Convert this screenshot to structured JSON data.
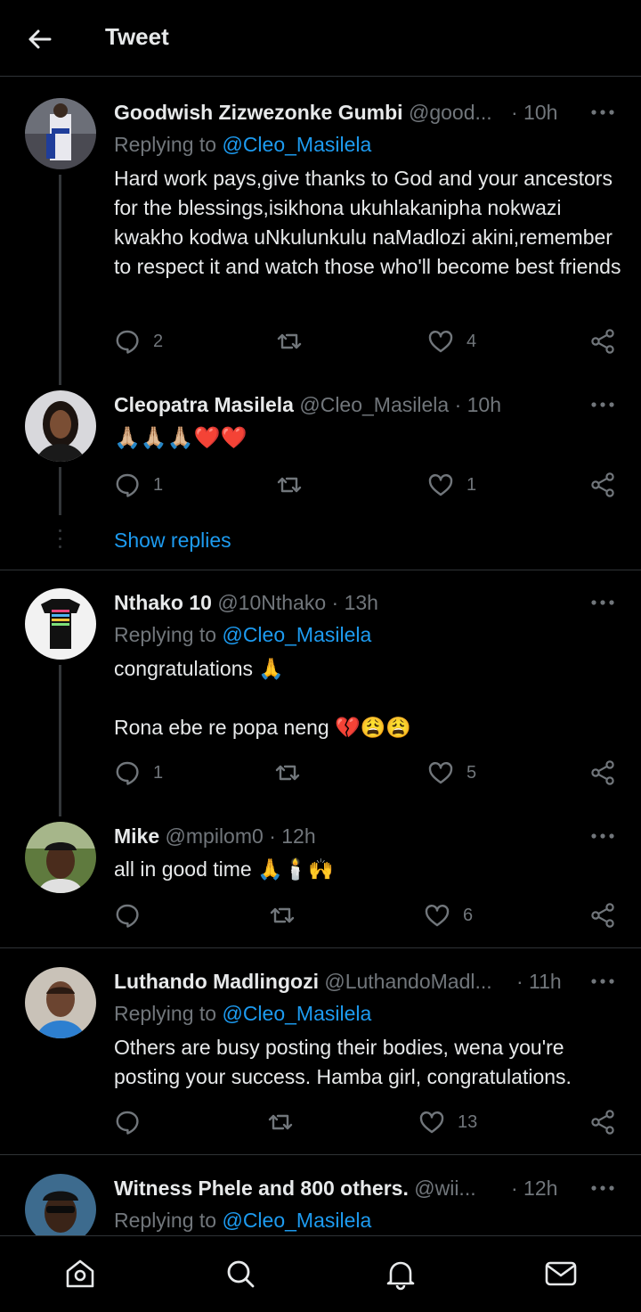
{
  "header": {
    "title": "Tweet",
    "back_icon": "arrow-left-icon"
  },
  "tweets": [
    {
      "name": "Goodwish Zizwezonke Gumbi",
      "handle": "@good...",
      "time": "· 10h",
      "replying_prefix": "Replying to",
      "replying_to": "@Cleo_Masilela",
      "text": "Hard work pays,give thanks to God and your ancestors for the blessings,isikhona ukuhlakanipha nokwazi kwakho kodwa uNkulunkulu naMadlozi akini,remember to respect it and watch those who'll become best friends",
      "replies": "2",
      "retweets": "",
      "likes": "4"
    },
    {
      "name": "Cleopatra Masilela",
      "handle": "@Cleo_Masilela",
      "time": "· 10h",
      "text": "🙏🏼🙏🏼🙏🏼❤️❤️",
      "replies": "1",
      "retweets": "",
      "likes": "1",
      "show_replies": "Show replies"
    },
    {
      "name": "Nthako 10",
      "handle": "@10Nthako",
      "time": "· 13h",
      "replying_prefix": "Replying to",
      "replying_to": "@Cleo_Masilela",
      "text_line1": "congratulations  🙏",
      "text_line2": "Rona ebe re popa neng 💔😩😩",
      "replies": "1",
      "retweets": "",
      "likes": "5"
    },
    {
      "name": "Mike",
      "handle": "@mpilom0",
      "time": "· 12h",
      "text": "all in good time 🙏🕯️🙌",
      "replies": "",
      "retweets": "",
      "likes": "6"
    },
    {
      "name": "Luthando Madlingozi",
      "handle": "@LuthandoMadl...",
      "time": "· 11h",
      "replying_prefix": "Replying to",
      "replying_to": "@Cleo_Masilela",
      "text": "Others are busy posting their bodies, wena you're posting your success. Hamba girl, congratulations.",
      "replies": "",
      "retweets": "",
      "likes": "13"
    },
    {
      "name": "Witness Phele and 800 others.",
      "handle": "@wii...",
      "time": "· 12h",
      "replying_prefix": "Replying to",
      "replying_to": "@Cleo_Masilela"
    }
  ],
  "bottom_nav": [
    "home-icon",
    "search-icon",
    "notifications-bell-icon",
    "messages-envelope-icon"
  ],
  "colors": {
    "background": "#000000",
    "accent": "#1d9bf0",
    "muted": "#71767b",
    "text": "#e7e9ea",
    "divider": "#2f3336"
  }
}
